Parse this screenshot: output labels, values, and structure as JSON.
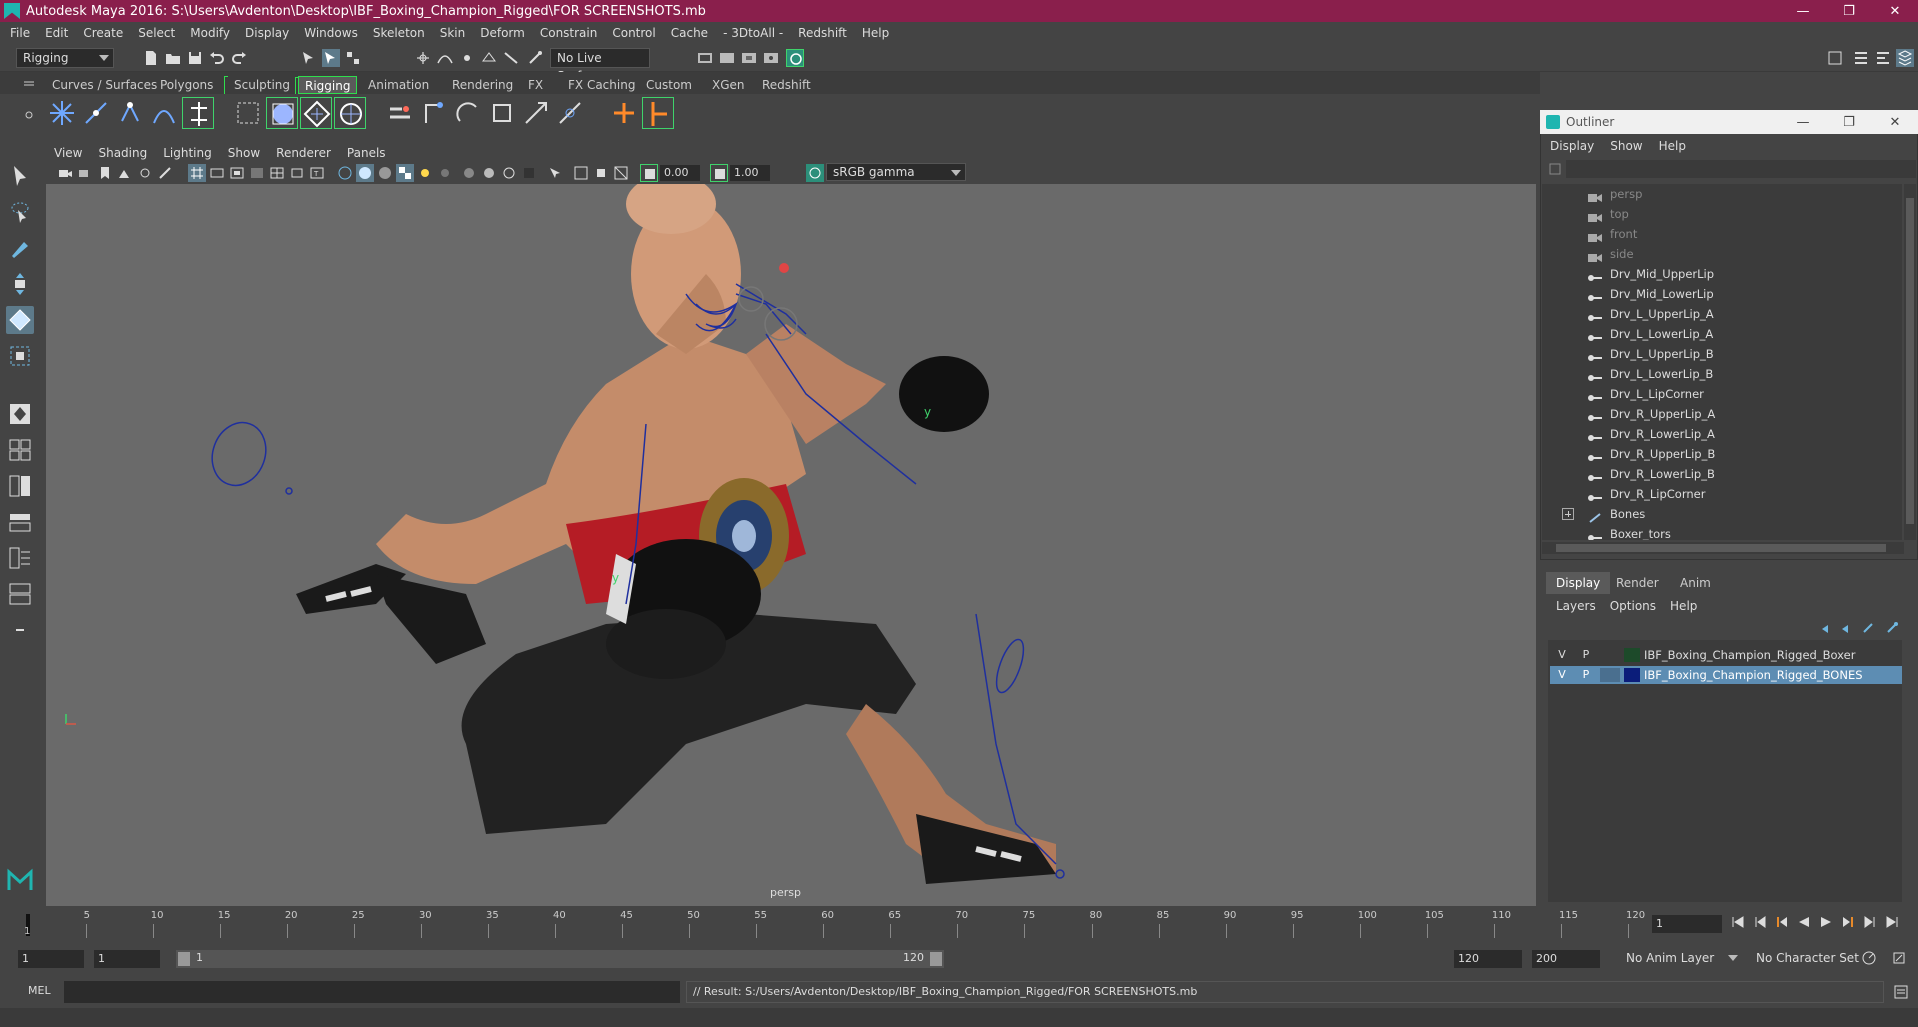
{
  "window": {
    "title": "Autodesk Maya 2016: S:\\Users\\Avdenton\\Desktop\\IBF_Boxing_Champion_Rigged\\FOR SCREENSHOTS.mb",
    "minimize": "—",
    "maximize": "❐",
    "close": "✕"
  },
  "menu": [
    "File",
    "Edit",
    "Create",
    "Select",
    "Modify",
    "Display",
    "Windows",
    "Skeleton",
    "Skin",
    "Deform",
    "Constrain",
    "Control",
    "Cache",
    "- 3DtoAll -",
    "Redshift",
    "Help"
  ],
  "statusline": {
    "mode": "Rigging",
    "live_surface": "No Live Surface"
  },
  "shelf": {
    "tabs": [
      "Curves / Surfaces",
      "Polygons",
      "Sculpting",
      "Rigging",
      "Animation",
      "Rendering",
      "FX",
      "FX Caching",
      "Custom",
      "XGen",
      "Redshift"
    ],
    "active": "Rigging"
  },
  "viewport": {
    "menu": [
      "View",
      "Shading",
      "Lighting",
      "Show",
      "Renderer",
      "Panels"
    ],
    "exposure": "0.00",
    "gamma": "1.00",
    "color_space": "sRGB gamma",
    "camera": "persp",
    "axis_y": "y",
    "axis_x": "x"
  },
  "outliner": {
    "title": "Outliner",
    "menu": [
      "Display",
      "Show",
      "Help"
    ],
    "items": [
      {
        "label": "persp",
        "kind": "camera",
        "dim": true
      },
      {
        "label": "top",
        "kind": "camera",
        "dim": true
      },
      {
        "label": "front",
        "kind": "camera",
        "dim": true
      },
      {
        "label": "side",
        "kind": "camera",
        "dim": true
      },
      {
        "label": "Drv_Mid_UpperLip",
        "kind": "joint"
      },
      {
        "label": "Drv_Mid_LowerLip",
        "kind": "joint"
      },
      {
        "label": "Drv_L_UpperLip_A",
        "kind": "joint"
      },
      {
        "label": "Drv_L_LowerLip_A",
        "kind": "joint"
      },
      {
        "label": "Drv_L_UpperLip_B",
        "kind": "joint"
      },
      {
        "label": "Drv_L_LowerLip_B",
        "kind": "joint"
      },
      {
        "label": "Drv_L_LipCorner",
        "kind": "joint"
      },
      {
        "label": "Drv_R_UpperLip_A",
        "kind": "joint"
      },
      {
        "label": "Drv_R_LowerLip_A",
        "kind": "joint"
      },
      {
        "label": "Drv_R_UpperLip_B",
        "kind": "joint"
      },
      {
        "label": "Drv_R_LowerLip_B",
        "kind": "joint"
      },
      {
        "label": "Drv_R_LipCorner",
        "kind": "joint"
      },
      {
        "label": "Bones",
        "kind": "group"
      },
      {
        "label": "Boxer_tors",
        "kind": "joint"
      }
    ]
  },
  "layers": {
    "tabs": [
      "Display",
      "Render",
      "Anim"
    ],
    "active_tab": "Display",
    "menu": [
      "Layers",
      "Options",
      "Help"
    ],
    "rows": [
      {
        "v": "V",
        "p": "P",
        "color": "#1d4a2a",
        "name": "IBF_Boxing_Champion_Rigged_Boxer",
        "selected": false
      },
      {
        "v": "V",
        "p": "P",
        "color": "#0b1d7a",
        "name": "IBF_Boxing_Champion_Rigged_BONES",
        "selected": true
      }
    ]
  },
  "timeline": {
    "ticks": [
      "5",
      "10",
      "15",
      "20",
      "25",
      "30",
      "35",
      "40",
      "45",
      "50",
      "55",
      "60",
      "65",
      "70",
      "75",
      "80",
      "85",
      "90",
      "95",
      "100",
      "105",
      "110",
      "115",
      "120"
    ],
    "start_tick": "1",
    "current_frame": "1",
    "range_start": "1",
    "range_start2": "1",
    "range_inner_start": "1",
    "range_inner_end": "120",
    "range_end": "120",
    "range_end2": "200",
    "anim_layer": "No Anim Layer",
    "character_set": "No Character Set"
  },
  "command": {
    "lang": "MEL",
    "result": "// Result: S:/Users/Avdenton/Desktop/IBF_Boxing_Champion_Rigged/FOR SCREENSHOTS.mb"
  }
}
